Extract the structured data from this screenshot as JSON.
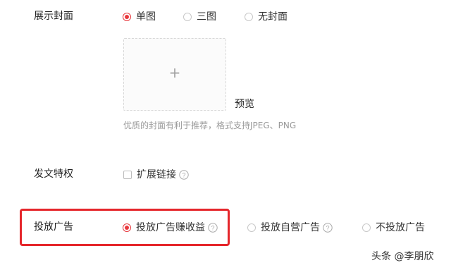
{
  "cover": {
    "label": "展示封面",
    "options": [
      {
        "label": "单图",
        "selected": true
      },
      {
        "label": "三图",
        "selected": false
      },
      {
        "label": "无封面",
        "selected": false
      }
    ],
    "upload_symbol": "+",
    "preview_label": "预览",
    "hint": "优质的封面有利于推荐，格式支持JPEG、PNG"
  },
  "privilege": {
    "label": "发文特权",
    "checkbox_label": "扩展链接",
    "checked": false
  },
  "ads": {
    "label": "投放广告",
    "options": [
      {
        "label": "投放广告赚收益",
        "selected": true,
        "help": true
      },
      {
        "label": "投放自营广告",
        "selected": false,
        "help": true
      },
      {
        "label": "不投放广告",
        "selected": false,
        "help": false
      }
    ],
    "highlight_color": "#e5262b"
  },
  "watermark": "头条 @李朋欣",
  "colors": {
    "accent": "#e8383d",
    "text": "#222222",
    "hint": "#999999"
  }
}
